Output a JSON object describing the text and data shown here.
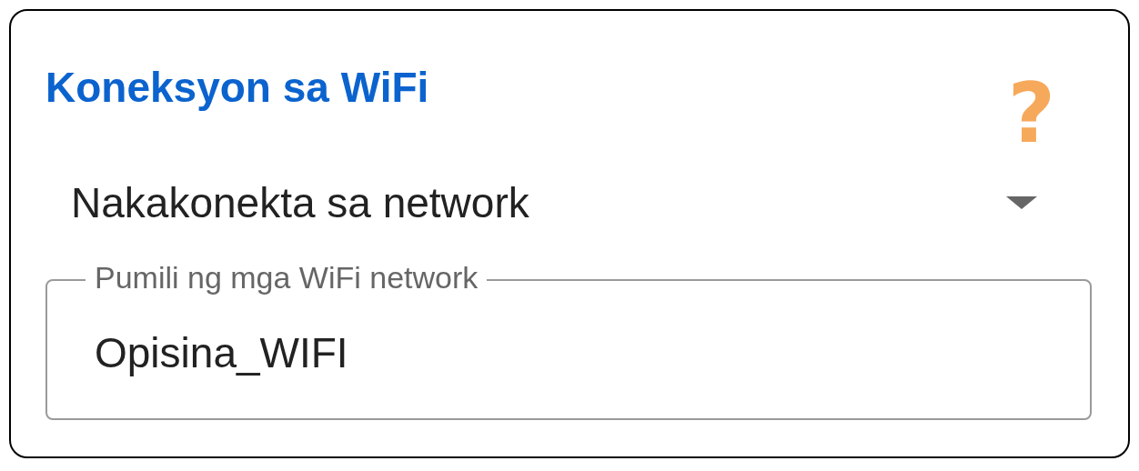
{
  "card": {
    "title": "Koneksyon sa WiFi",
    "help": "?"
  },
  "dropdown": {
    "value": "Nakakonekta sa network"
  },
  "network_field": {
    "label": "Pumili ng mga WiFi network",
    "value": "Opisina_WIFI"
  }
}
